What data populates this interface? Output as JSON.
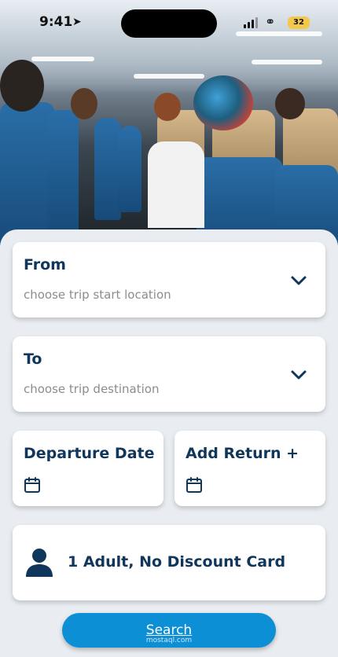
{
  "status_bar": {
    "time": "9:41",
    "battery": "32"
  },
  "form": {
    "from": {
      "label": "From",
      "placeholder": "choose trip start location"
    },
    "to": {
      "label": "To",
      "placeholder": "choose trip destination"
    },
    "departure": {
      "label": "Departure Date"
    },
    "return": {
      "label": "Add Return +"
    },
    "passengers": {
      "label": "1 Adult, No Discount Card"
    }
  },
  "search_button": {
    "label": "Search"
  },
  "watermark": "mostaql.com",
  "icons": {
    "chevron": "chevron-down-icon",
    "calendar": "calendar-icon",
    "person": "person-icon",
    "location": "location-arrow-icon"
  },
  "colors": {
    "primary_text": "#10365c",
    "button": "#0d8fd6",
    "background": "#e9edf1"
  }
}
